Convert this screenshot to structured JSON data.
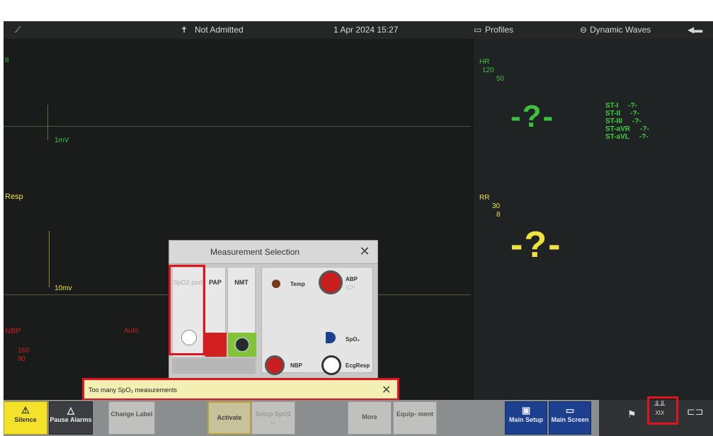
{
  "topbar": {
    "admit_status": "Not Admitted",
    "datetime": "1 Apr 2024 15:27",
    "profiles": "Profiles",
    "dynamic_waves": "Dynamic Waves"
  },
  "waves": {
    "resp_label": "Resp",
    "resp_scale": "10mv",
    "ecg_scale": "1mV",
    "nbp_label": "NBP",
    "nbp_sub": "Auto"
  },
  "vitals": {
    "hr_label": "HR",
    "hr_upper": "120",
    "hr_lower": "50",
    "hr_value": "-?-",
    "rr_label": "RR",
    "rr_upper": "30",
    "rr_lower": "8",
    "rr_value": "-?-",
    "st_labels": [
      "ST-I",
      "ST-II",
      "ST-III",
      "ST-aVR",
      "ST-aVL"
    ],
    "st_values": [
      "-?-",
      "-?-",
      "-?-",
      "-?-",
      "-?-"
    ]
  },
  "dialog": {
    "title": "Measurement Selection",
    "columns": [
      "SpO2 pod",
      "PAP",
      "NMT"
    ],
    "items": {
      "temp": "Temp",
      "abp": "ABP",
      "icp": "ICP",
      "spo2": "SpO₂",
      "nbp": "NBP",
      "ecgresp": "EcgResp"
    }
  },
  "tooltip": {
    "message": "Too many SpO₂ measurements"
  },
  "bottombar": {
    "silence": "Silence",
    "pause_alarms": "Pause Alarms",
    "change_label": "Change Label",
    "activate": "Activate",
    "setup_sdc": "Setup SpO2 ...",
    "more": "More",
    "equipment": "Equip- ment",
    "main_setup": "Main Setup",
    "main_screen": "Main Screen",
    "xix": "XIX"
  },
  "colors": {
    "alarm_yellow": "#f3e12a",
    "wave_green": "#3fbf3f",
    "highlight_red": "#e0141e",
    "main_blue": "#1c3f8e"
  }
}
